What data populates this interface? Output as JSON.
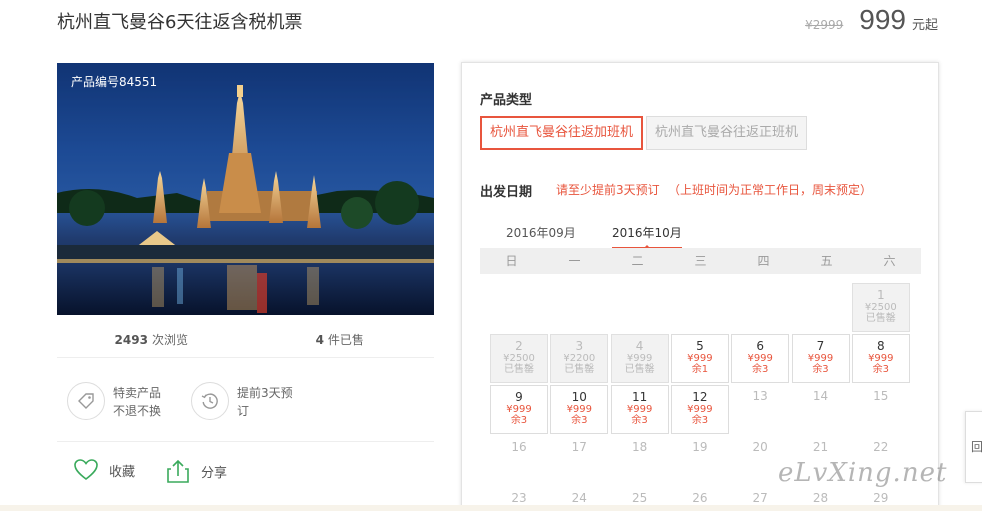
{
  "product": {
    "title": "杭州直飞曼谷6天往返含税机票",
    "old_price": "¥2999",
    "price": "999",
    "price_unit": "元起",
    "code": "产品编号84551"
  },
  "stats": {
    "views_count": "2493",
    "views_label": "次浏览",
    "sold_count": "4",
    "sold_label": "件已售"
  },
  "features": [
    {
      "icon": "tag-icon",
      "line1": "特卖产品",
      "line2": "不退不换"
    },
    {
      "icon": "history-clock-icon",
      "line1": "提前3天预",
      "line2": "订"
    }
  ],
  "actions": {
    "favorite_label": "收藏",
    "share_label": "分享"
  },
  "booking": {
    "type_label": "产品类型",
    "types": [
      {
        "label": "杭州直飞曼谷往返加班机",
        "selected": true
      },
      {
        "label": "杭州直飞曼谷往返正班机",
        "selected": false
      }
    ],
    "date_label": "出发日期",
    "note1": "请至少提前3天预订",
    "note2": "（上班时间为正常工作日，周末预定）",
    "months": [
      "2016年09月",
      "2016年10月"
    ],
    "active_month": "2016年10月",
    "weekdays": [
      "日",
      "一",
      "二",
      "三",
      "四",
      "五",
      "六"
    ],
    "days": [
      {
        "day": "1",
        "price": "¥2500",
        "status": "已售罄",
        "state": "sold"
      },
      {
        "day": "2",
        "price": "¥2500",
        "status": "已售罄",
        "state": "sold"
      },
      {
        "day": "3",
        "price": "¥2200",
        "status": "已售罄",
        "state": "sold"
      },
      {
        "day": "4",
        "price": "¥999",
        "status": "已售罄",
        "state": "sold"
      },
      {
        "day": "5",
        "price": "¥999",
        "status": "余1",
        "state": "avail"
      },
      {
        "day": "6",
        "price": "¥999",
        "status": "余3",
        "state": "avail"
      },
      {
        "day": "7",
        "price": "¥999",
        "status": "余3",
        "state": "avail"
      },
      {
        "day": "8",
        "price": "¥999",
        "status": "余3",
        "state": "avail"
      },
      {
        "day": "9",
        "price": "¥999",
        "status": "余3",
        "state": "avail"
      },
      {
        "day": "10",
        "price": "¥999",
        "status": "余3",
        "state": "avail"
      },
      {
        "day": "11",
        "price": "¥999",
        "status": "余3",
        "state": "avail"
      },
      {
        "day": "12",
        "price": "¥999",
        "status": "余3",
        "state": "avail"
      },
      {
        "day": "13",
        "state": "empty"
      },
      {
        "day": "14",
        "state": "empty"
      },
      {
        "day": "15",
        "state": "empty"
      },
      {
        "day": "16",
        "state": "empty"
      },
      {
        "day": "17",
        "state": "empty"
      },
      {
        "day": "18",
        "state": "empty"
      },
      {
        "day": "19",
        "state": "empty"
      },
      {
        "day": "20",
        "state": "empty"
      },
      {
        "day": "21",
        "state": "empty"
      },
      {
        "day": "22",
        "state": "empty"
      },
      {
        "day": "23",
        "state": "empty"
      },
      {
        "day": "24",
        "state": "empty"
      },
      {
        "day": "25",
        "state": "empty"
      },
      {
        "day": "26",
        "state": "empty"
      },
      {
        "day": "27",
        "state": "empty"
      },
      {
        "day": "28",
        "state": "empty"
      },
      {
        "day": "29",
        "state": "empty"
      }
    ]
  },
  "watermark": "eLvXing.net",
  "side_tab": "回",
  "colors": {
    "accent": "#e8553d",
    "icon_green": "#3aaa5c"
  }
}
